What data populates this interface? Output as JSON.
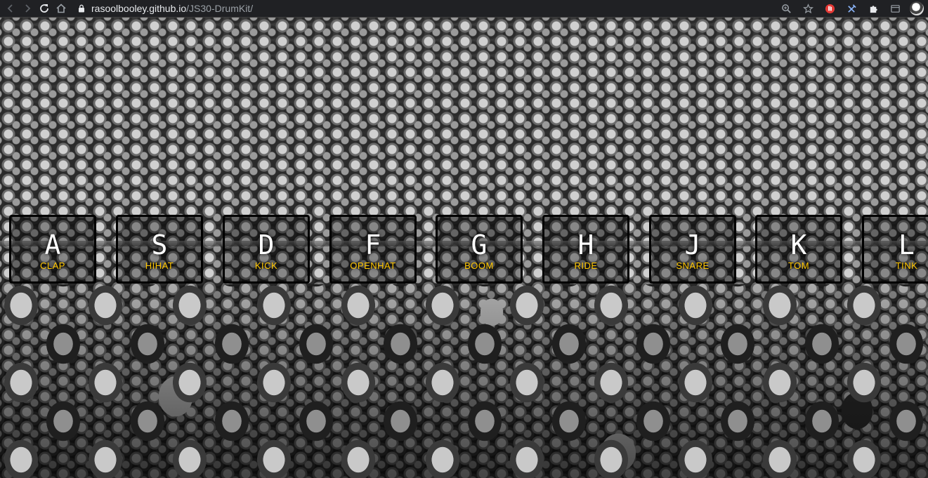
{
  "browser": {
    "url_host": "rasoolbooley.github.io",
    "url_path": "/JS30-DrumKit/"
  },
  "colors": {
    "accent": "#ffc600",
    "key_border": "#000000",
    "chrome_bg": "#202124"
  },
  "keys": [
    {
      "key": "A",
      "sound": "CLAP"
    },
    {
      "key": "S",
      "sound": "HIHAT"
    },
    {
      "key": "D",
      "sound": "KICK"
    },
    {
      "key": "F",
      "sound": "OPENHAT"
    },
    {
      "key": "G",
      "sound": "BOOM"
    },
    {
      "key": "H",
      "sound": "RIDE"
    },
    {
      "key": "J",
      "sound": "SNARE"
    },
    {
      "key": "K",
      "sound": "TOM"
    },
    {
      "key": "L",
      "sound": "TINK"
    }
  ]
}
